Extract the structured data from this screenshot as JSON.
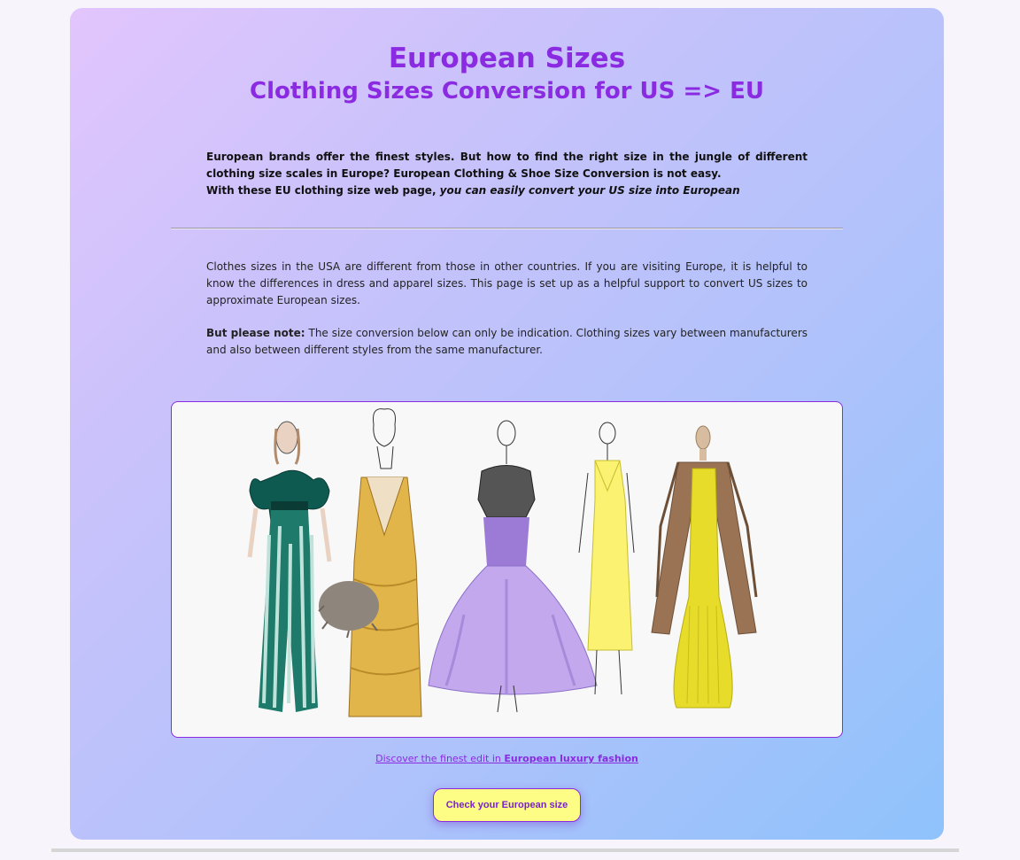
{
  "header": {
    "title": "European Sizes",
    "subtitle": "Clothing Sizes Conversion for US => EU"
  },
  "intro": {
    "line1": "European brands offer the finest styles. But how to find the right size in the jungle of different clothing size scales in Europe? European Clothing & Shoe Size Conversion is not easy.",
    "line2_prefix": "With these EU clothing size web page,",
    "line2_emphasis": " you can easily convert your US size into European"
  },
  "body": {
    "paragraph1": "Clothes sizes in the USA are different from those in other countries. If you are visiting Europe, it is helpful to know the differences in dress and apparel sizes. This page is set up as a helpful support to convert US sizes to approximate European sizes.",
    "note_label": "But please note:",
    "note_text": " The size conversion below can only be indication. Clothing sizes vary between manufacturers and also between different styles from the same manufacturer."
  },
  "illustration": {
    "name": "fashion-sketches-image"
  },
  "discover": {
    "prefix": "Discover the finest edit in ",
    "link_label": "European luxury fashion"
  },
  "cta": {
    "label": "Check your European size"
  },
  "colors": {
    "accent": "#8a2be2",
    "button_bg": "#fdfd86"
  }
}
